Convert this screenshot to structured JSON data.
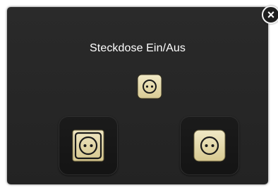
{
  "dialog": {
    "title": "Steckdose Ein/Aus"
  },
  "icons": {
    "close": "close-icon",
    "status": "socket-status-icon",
    "off_button": "socket-off-icon",
    "on_button": "socket-on-icon"
  },
  "close_button": {
    "label": "×"
  },
  "colors": {
    "dialog_background": "#262626",
    "socket_gold": "#e8ddb0",
    "socket_outline": "#151515"
  }
}
